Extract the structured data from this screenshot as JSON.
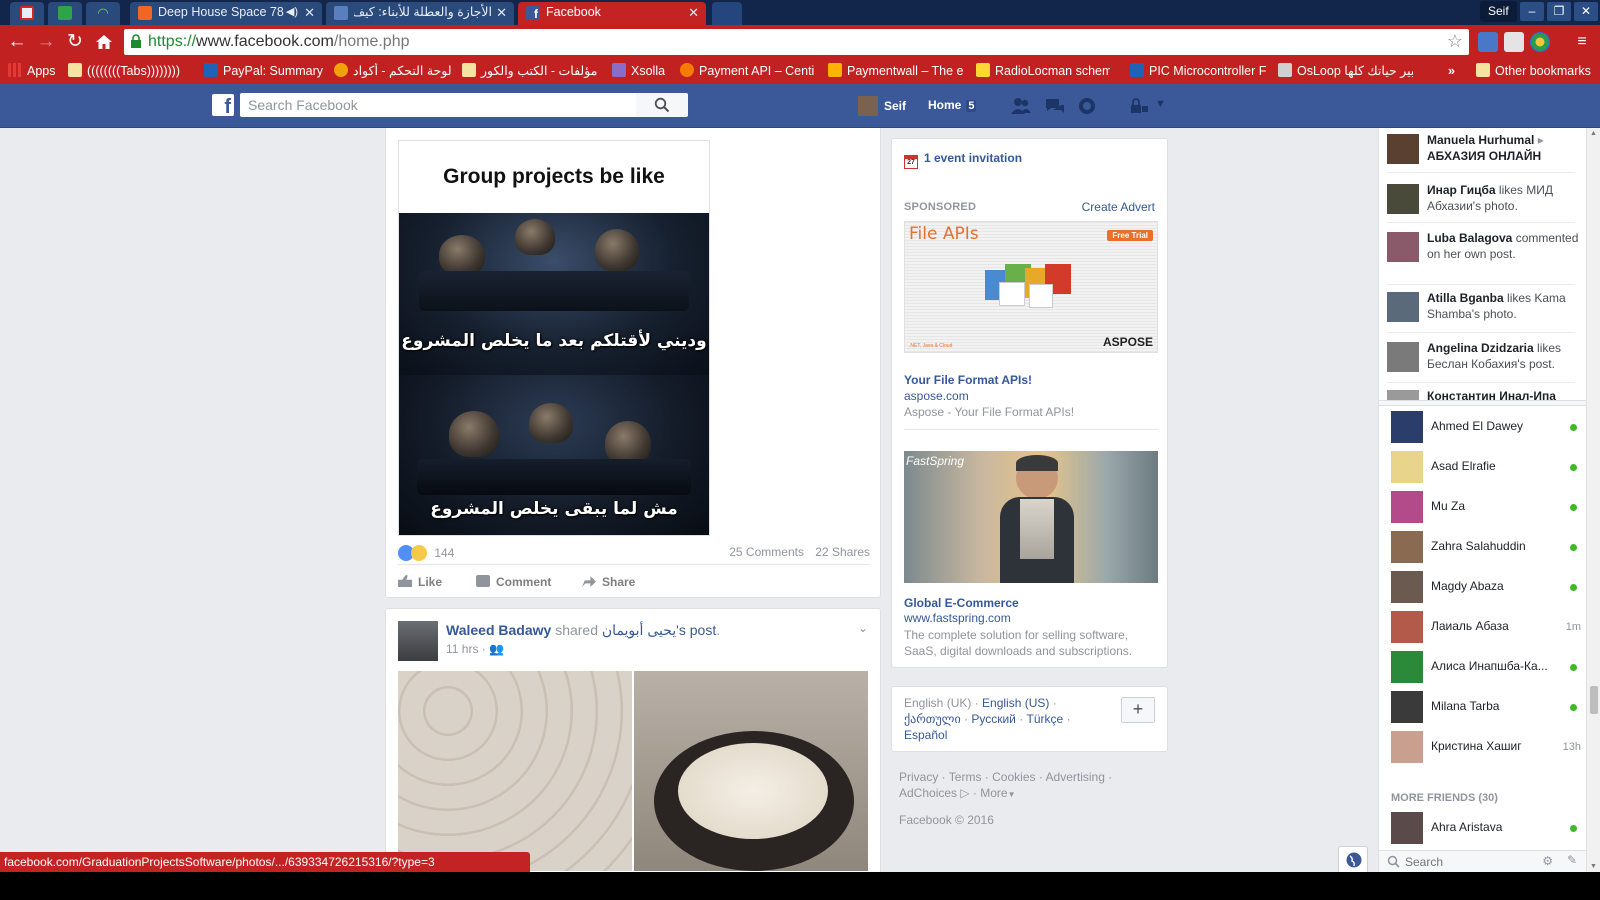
{
  "browser": {
    "tabs": [
      {
        "title": "",
        "pinned": true,
        "favicon_color": "#e8eef8"
      },
      {
        "title": "",
        "pinned": true,
        "favicon_color": "#2fa34a"
      },
      {
        "title": "",
        "pinned": true,
        "favicon_color": "#7dd04a"
      },
      {
        "title": "Deep House Space 78",
        "pinned": false,
        "favicon_color": "#f26522",
        "audio": true
      },
      {
        "title": "الأجازة والعطلة للأبناء: كيف",
        "pinned": false,
        "favicon_color": "#5a7fbf"
      },
      {
        "title": "Facebook",
        "pinned": false,
        "active": true,
        "favicon_color": "#3b5998"
      }
    ],
    "profile_name": "Seif",
    "window_buttons": {
      "minimize": "–",
      "restore": "❐",
      "close": "✕"
    },
    "url": {
      "scheme": "https://",
      "host": "www.facebook.com",
      "path": "/home.php"
    },
    "bookmarks": [
      {
        "label": "Apps",
        "icon_color": "#e53935"
      },
      {
        "label": "((((((((Tabs))))))))",
        "icon_color": "#f5e3a1"
      },
      {
        "label": "PayPal: Summary",
        "icon_color": "#1e63b5"
      },
      {
        "label": "لوحة التحكم - أكواد",
        "icon_color": "#f2a20c"
      },
      {
        "label": "مؤلفات - الكتب والكور",
        "icon_color": "#f5e3a1"
      },
      {
        "label": "Xsolla",
        "icon_color": "#8a6cc9"
      },
      {
        "label": "Payment API – Centi",
        "icon_color": "#f57c00"
      },
      {
        "label": "Paymentwall – The e",
        "icon_color": "#ffb300"
      },
      {
        "label": "RadioLocman schem",
        "icon_color": "#fdd835"
      },
      {
        "label": "PIC Microcontroller F",
        "icon_color": "#1e63b5"
      },
      {
        "label": "OsLoop بير حياتك كلها",
        "icon_color": "#d0d0d0"
      },
      {
        "label": "»",
        "icon_color": ""
      },
      {
        "label": "Other bookmarks",
        "icon_color": "#f5e3a1"
      }
    ],
    "status_url": "facebook.com/GraduationProjectsSoftware/photos/.../639334726215316/?type=3"
  },
  "fb_header": {
    "search_placeholder": "Search Facebook",
    "user_name": "Seif",
    "home_label": "Home",
    "home_count": "5"
  },
  "post1": {
    "meme_title": "Group projects be like",
    "caption_top": "وديني لأقتلكم بعد ما يخلص المشروع",
    "caption_bottom": "مش لما يبقى يخلص المشروع",
    "reactions_count": "144",
    "comments": "25 Comments",
    "shares": "22 Shares",
    "actions": {
      "like": "Like",
      "comment": "Comment",
      "share": "Share"
    }
  },
  "post2": {
    "author": "Waleed Badawy",
    "shared_text": "shared",
    "original_author": "يحيى أبويمان",
    "possessive": "'s",
    "post_word": "post",
    "time": "11 hrs ·"
  },
  "right_column": {
    "event_invites": "1 event invitation",
    "calendar_day": "27",
    "sponsored_label": "SPONSORED",
    "create_advert": "Create Advert",
    "ads": [
      {
        "image_heading": "File APIs",
        "image_badge": "Free Trial",
        "image_brand": "ASPOSE",
        "image_tagline": ".NET, Java & Cloud",
        "title": "Your File Format APIs!",
        "url": "aspose.com",
        "description": "Aspose - Your File Format APIs!"
      },
      {
        "image_brand": "FastSpring",
        "title": "Global E-Commerce",
        "url": "www.fastspring.com",
        "description": "The complete solution for selling software, SaaS, digital downloads and subscriptions."
      }
    ],
    "languages": {
      "current": "English (UK) ·",
      "options": [
        "English (US)",
        "ქართული",
        "Русский",
        "Türkçe",
        "Español"
      ]
    },
    "footer_links": [
      "Privacy",
      "Terms",
      "Cookies",
      "Advertising",
      "AdChoices",
      "More"
    ],
    "copyright": "Facebook © 2016"
  },
  "ticker": [
    {
      "name": "Manuela Hurhumal",
      "arrow": "▸",
      "text": "АБХАЗИЯ ОНЛАЙН",
      "avatar_color": "#5a4030"
    },
    {
      "name": "Инар Гицба",
      "text": "likes МИД Абхазии's photo.",
      "avatar_color": "#4a4a3a"
    },
    {
      "name": "Luba Balagova",
      "text": "commented on her own post.",
      "avatar_color": "#8a5a6a"
    },
    {
      "name": "Atilla Bganba",
      "text": "likes Kama Shamba's photo.",
      "avatar_color": "#5a6a7a"
    },
    {
      "name": "Angelina Dzidzaria",
      "text": "likes Беслан Кобахия's post.",
      "avatar_color": "#7a7a7a"
    },
    {
      "name": "Константин Инал-Ипа",
      "text": "",
      "avatar_color": "#9a9a9a"
    }
  ],
  "chat": [
    {
      "name": "Ahmed El Dawey",
      "status": "online",
      "avatar_color": "#2b3d6b"
    },
    {
      "name": "Asad Elrafie",
      "status": "online",
      "avatar_color": "#e8d48a"
    },
    {
      "name": "Mu Za",
      "status": "online",
      "avatar_color": "#b34a8a"
    },
    {
      "name": "Zahra Salahuddin",
      "status": "online",
      "avatar_color": "#8a6a50"
    },
    {
      "name": "Magdy Abaza",
      "status": "online",
      "avatar_color": "#6a5a50"
    },
    {
      "name": "Лаиаль Абаза",
      "status": "1m",
      "avatar_color": "#b35a4a"
    },
    {
      "name": "Алиса Инапшба-Ка...",
      "status": "online",
      "avatar_color": "#2a8a3a"
    },
    {
      "name": "Milana Tarba",
      "status": "online",
      "avatar_color": "#3a3a3a"
    },
    {
      "name": "Кристина Хашиг",
      "status": "13h",
      "avatar_color": "#c9a090"
    }
  ],
  "more_friends": {
    "label": "MORE FRIENDS (30)",
    "first": {
      "name": "Ahra Aristava",
      "status": "online",
      "avatar_color": "#5a4a4a"
    }
  },
  "chat_search_placeholder": "Search"
}
